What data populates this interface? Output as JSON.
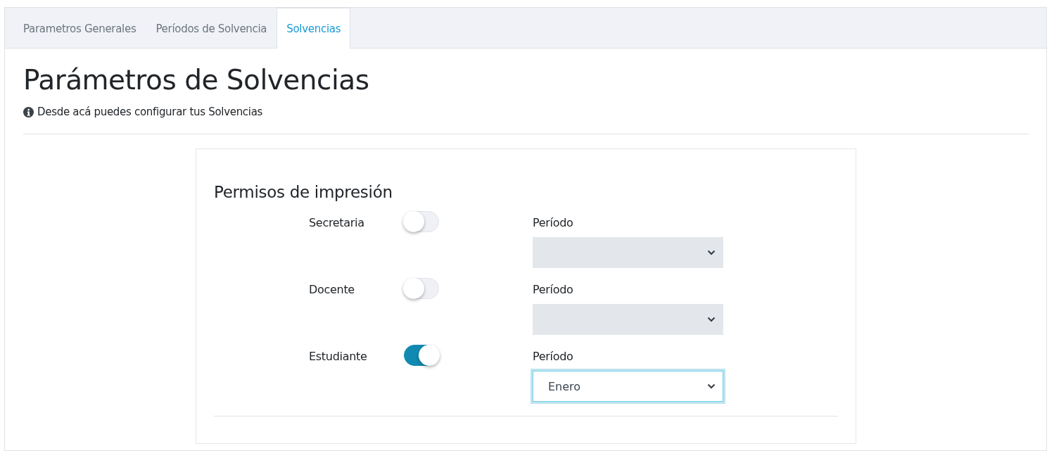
{
  "tabs": [
    {
      "label": "Parametros Generales",
      "selected": false
    },
    {
      "label": "Períodos de Solvencia",
      "selected": false
    },
    {
      "label": "Solvencias",
      "selected": true
    }
  ],
  "page": {
    "title": "Parámetros de Solvencias",
    "subtitle": "Desde acá puedes configurar tus Solvencias"
  },
  "card": {
    "title": "Permisos de impresión",
    "rows": [
      {
        "label": "Secretaria",
        "on": false,
        "select_label": "Período",
        "select": {
          "disabled": true,
          "focused": false
        }
      },
      {
        "label": "Docente",
        "on": false,
        "select_label": "Período",
        "select": {
          "disabled": true,
          "focused": false
        }
      },
      {
        "label": "Estudiante",
        "on": true,
        "select_label": "Período",
        "select": {
          "value": "Enero",
          "disabled": false,
          "focused": true
        }
      }
    ]
  }
}
